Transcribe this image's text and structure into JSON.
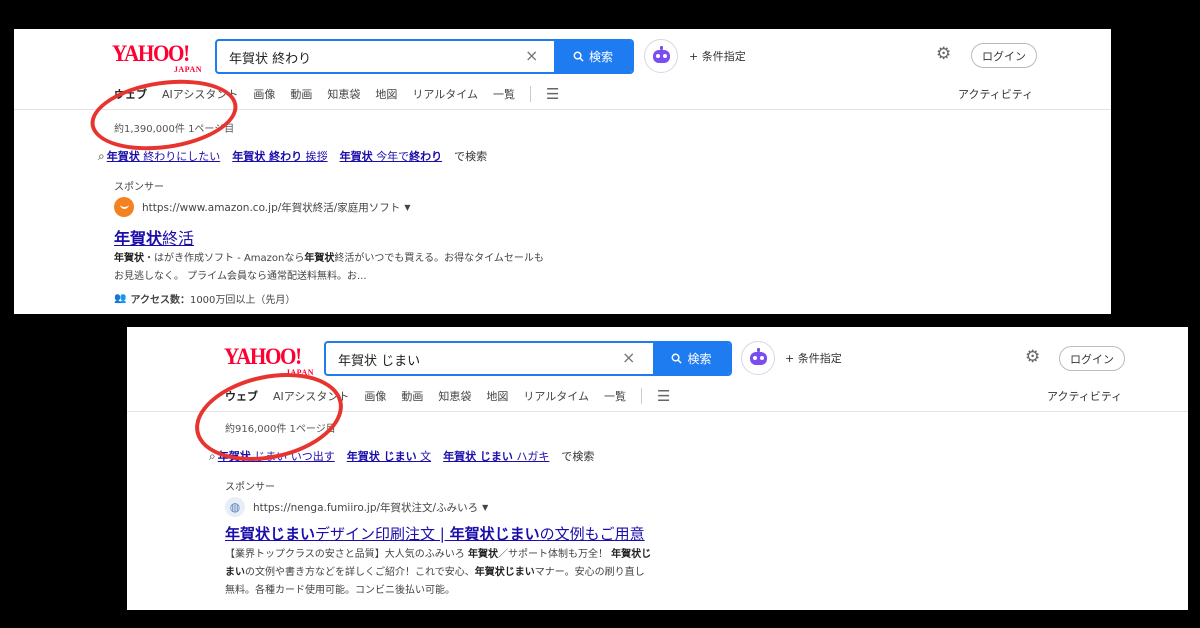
{
  "panels": [
    {
      "logo": {
        "main": "YAHOO!",
        "sub": "JAPAN"
      },
      "search": {
        "query": "年賀状 終わり",
        "clear": "×",
        "button": "検索"
      },
      "conditions": "+ 条件指定",
      "login": "ログイン",
      "tabs": [
        "ウェブ",
        "AIアシスタント",
        "画像",
        "動画",
        "知恵袋",
        "地図",
        "リアルタイム",
        "一覧"
      ],
      "activity": "アクティビティ",
      "count": "約1,390,000件 1ページ目",
      "related": {
        "items": [
          {
            "bold": "年賀状",
            "rest": " 終わりにしたい"
          },
          {
            "bold": "年賀状 終わり",
            "rest": " 挨拶"
          },
          {
            "bold": "年賀状",
            "rest": " 今年で",
            "bold2": "終わり"
          }
        ],
        "suffix": "で検索"
      },
      "ad": {
        "sponsor": "スポンサー",
        "url": "https://www.amazon.co.jp/年賀状終活/家庭用ソフト",
        "title_bold": "年賀状",
        "title_rest": "終活",
        "desc_line1_bold": "年賀状",
        "desc_line1_a": "・はがき作成ソフト - Amazonなら",
        "desc_line1_bold2": "年賀状",
        "desc_line1_b": "終活がいつでも買える。お得なタイムセールも",
        "desc_line2": "お見逃しなく。 プライム会員なら通常配送料無料。お...",
        "access_label": "アクセス数：",
        "access_value": "1000万回以上（先月）"
      }
    },
    {
      "logo": {
        "main": "YAHOO!",
        "sub": "JAPAN"
      },
      "search": {
        "query": "年賀状 じまい",
        "clear": "×",
        "button": "検索"
      },
      "conditions": "+ 条件指定",
      "login": "ログイン",
      "tabs": [
        "ウェブ",
        "AIアシスタント",
        "画像",
        "動画",
        "知恵袋",
        "地図",
        "リアルタイム",
        "一覧"
      ],
      "activity": "アクティビティ",
      "count": "約916,000件 1ページ目",
      "related": {
        "items": [
          {
            "bold": "年賀状",
            "rest": " じまい いつ出す"
          },
          {
            "bold": "年賀状 じまい",
            "rest": " 文"
          },
          {
            "bold": "年賀状 じまい",
            "rest": " ハガキ"
          }
        ],
        "suffix": "で検索"
      },
      "ad": {
        "sponsor": "スポンサー",
        "url": "https://nenga.fumiiro.jp/年賀状注文/ふみいろ",
        "title_bold1": "年賀状じまい",
        "title_mid": "デザイン印刷注文 | ",
        "title_bold2": "年賀状じまい",
        "title_end": "の文例もご用意",
        "desc_line1_a": "【業界トップクラスの安さと品質】大人気のふみいろ ",
        "desc_line1_bold": "年賀状",
        "desc_line1_b": "／サポート体制も万全！ ",
        "desc_line1_bold2": "年賀状じ",
        "desc_line2_bold": "まい",
        "desc_line2_a": "の文例や書き方などを詳しくご紹介！これで安心、",
        "desc_line2_bold2": "年賀状じまい",
        "desc_line2_b": "マナー。安心の刷り直し",
        "desc_line3": "無料。各種カード使用可能。コンビニ後払い可能。"
      }
    }
  ],
  "colors": {
    "accent": "#1f7cf0",
    "link": "#1a0dab",
    "annotation": "#e8342f",
    "brand": "#ff0033"
  },
  "icons": [
    "search-icon",
    "close-icon",
    "robot-icon",
    "gear-icon",
    "filter-icon",
    "globe-icon",
    "amazon-icon",
    "people-icon"
  ]
}
